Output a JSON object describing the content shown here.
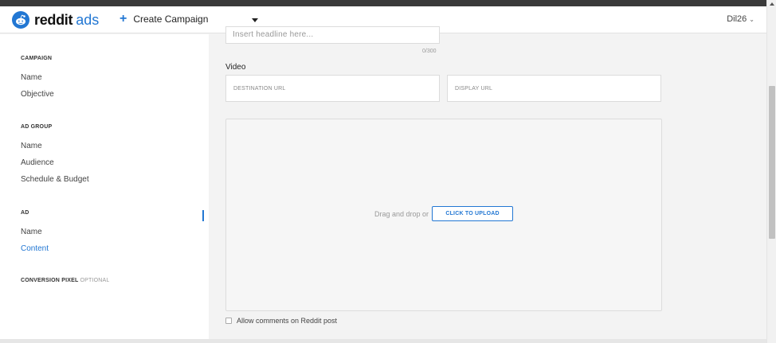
{
  "header": {
    "logo_word": "reddit",
    "logo_ads": "ads",
    "create_label": "Create Campaign",
    "user": "Dil26"
  },
  "sidebar": {
    "campaign": {
      "title": "CAMPAIGN",
      "items": [
        "Name",
        "Objective"
      ]
    },
    "ad_group": {
      "title": "AD GROUP",
      "items": [
        "Name",
        "Audience",
        "Schedule & Budget"
      ]
    },
    "ad": {
      "title": "AD",
      "items": [
        "Name",
        "Content"
      ]
    },
    "conversion": {
      "title": "CONVERSION PIXEL",
      "optional": "OPTIONAL"
    },
    "active_item": "Content"
  },
  "main": {
    "headline_placeholder": "Insert headline here...",
    "headline_counter": "0/300",
    "video_label": "Video",
    "destination_url_placeholder": "DESTINATION URL",
    "display_url_placeholder": "DISPLAY URL",
    "drag_text": "Drag and drop or",
    "upload_button": "CLICK TO UPLOAD",
    "allow_comments": "Allow comments on Reddit post"
  },
  "colors": {
    "accent": "#2277d3",
    "background": "#f3f3f3"
  }
}
